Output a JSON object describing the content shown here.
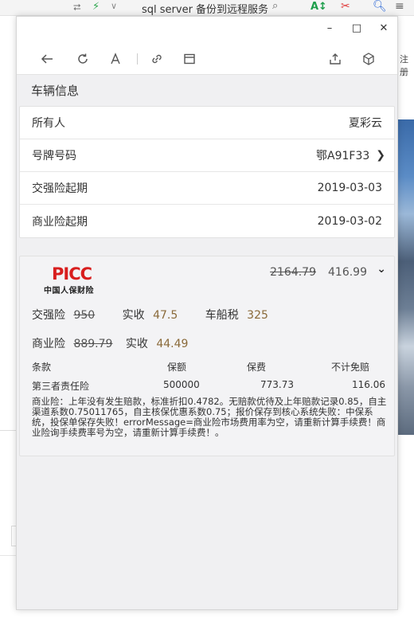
{
  "browser": {
    "search_text": "sql server 备份到远程服务",
    "side_text": "注册"
  },
  "toolbar": {
    "back_icon": "arrow-left-icon",
    "refresh_icon": "refresh-icon",
    "font_icon": "font-icon",
    "link_icon": "link-icon",
    "window_icon": "window-icon",
    "share_icon": "share-icon",
    "cube_icon": "cube-icon"
  },
  "vehicle": {
    "section_title": "车辆信息",
    "rows": [
      {
        "label": "所有人",
        "value": "夏彩云"
      },
      {
        "label": "号牌号码",
        "value": "鄂A91F33"
      },
      {
        "label": "交强险起期",
        "value": "2019-03-03"
      },
      {
        "label": "商业险起期",
        "value": "2019-03-02"
      }
    ]
  },
  "quote": {
    "logo_text": "PICC",
    "logo_subtext": "中国人保财险",
    "original_price": "2164.79",
    "final_price": "416.99",
    "compulsory_label": "交强险",
    "compulsory_original": "950",
    "actual_label": "实收",
    "compulsory_actual": "47.5",
    "vehicle_tax_label": "车船税",
    "vehicle_tax": "325",
    "commercial_label": "商业险",
    "commercial_original": "889.79",
    "commercial_actual": "44.49",
    "table_headers": [
      "条款",
      "保额",
      "保费",
      "不计免赔"
    ],
    "table_rows": [
      [
        "第三者责任险",
        "500000",
        "773.73",
        "116.06"
      ]
    ],
    "note": "商业险：上年没有发生赔款，标准折扣0.4782。无赔款优待及上年赔款记录0.85，自主渠道系数0.75011765，自主核保优惠系数0.75；报价保存到核心系统失败：中保系统，投保单保存失败！errorMessage=商业险市场费用率为空，请重新计算手续费！商业险询手续费率号为空，请重新计算手续费！。"
  }
}
